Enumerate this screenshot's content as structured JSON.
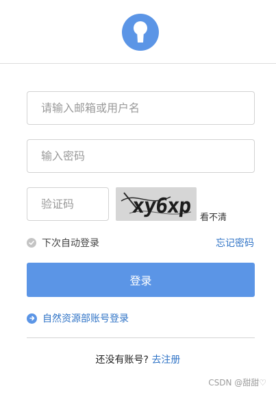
{
  "header": {
    "logo_icon": "keyhole-icon"
  },
  "form": {
    "username_placeholder": "请输入邮箱或用户名",
    "password_placeholder": "输入密码",
    "captcha_placeholder": "验证码",
    "captcha_image_text": "xy6xp",
    "refresh_captcha_label": "看不清",
    "remember_label": "下次自动登录",
    "forgot_password_label": "忘记密码",
    "login_label": "登录",
    "sso_label": "自然资源部账号登录",
    "no_account_label": "还没有账号?",
    "register_label": "去注册"
  },
  "watermark": {
    "text": "CSDN @甜甜♡"
  },
  "colors": {
    "accent": "#5b95e6",
    "link": "#2f73c6"
  }
}
